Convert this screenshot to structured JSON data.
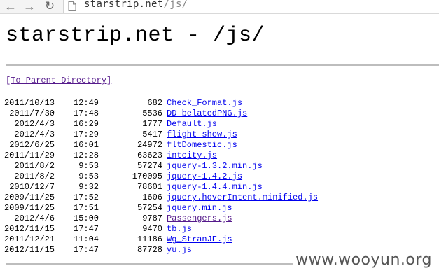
{
  "browser": {
    "url_host": "starstrip.net",
    "url_path": "/js/",
    "icons": {
      "back": "back-arrow-icon",
      "forward": "forward-arrow-icon",
      "reload": "reload-icon",
      "page": "page-icon"
    }
  },
  "page": {
    "title": "starstrip.net - /js/",
    "parent_link": "[To Parent Directory]"
  },
  "listing": [
    {
      "date": "2011/10/13",
      "time": "12:49",
      "size": "682",
      "name": "Check_Format.js"
    },
    {
      "date": "2011/7/30",
      "time": "17:48",
      "size": "5536",
      "name": "DD_belatedPNG.js"
    },
    {
      "date": "2012/4/3",
      "time": "16:29",
      "size": "1777",
      "name": "Default.js"
    },
    {
      "date": "2012/4/3",
      "time": "17:29",
      "size": "5417",
      "name": "flight_show.js"
    },
    {
      "date": "2012/6/25",
      "time": "16:01",
      "size": "24972",
      "name": "fltDomestic.js"
    },
    {
      "date": "2011/11/29",
      "time": "12:28",
      "size": "63623",
      "name": "intcity.js"
    },
    {
      "date": "2011/8/2",
      "time": "9:53",
      "size": "57274",
      "name": "jquery-1.3.2.min.js"
    },
    {
      "date": "2011/8/2",
      "time": "9:53",
      "size": "170095",
      "name": "jquery-1.4.2.js"
    },
    {
      "date": "2010/12/7",
      "time": "9:32",
      "size": "78601",
      "name": "jquery-1.4.4.min.js"
    },
    {
      "date": "2009/11/25",
      "time": "17:52",
      "size": "1606",
      "name": "jquery.hoverIntent.minified.js"
    },
    {
      "date": "2009/11/25",
      "time": "17:51",
      "size": "57254",
      "name": "jquery.min.js"
    },
    {
      "date": "2012/4/6",
      "time": "15:00",
      "size": "9787",
      "name": "Passengers.js"
    },
    {
      "date": "2012/11/15",
      "time": "17:47",
      "size": "9470",
      "name": "tb.js"
    },
    {
      "date": "2011/12/21",
      "time": "11:04",
      "size": "11186",
      "name": "Wg_StranJF.js"
    },
    {
      "date": "2012/11/15",
      "time": "17:47",
      "size": "87728",
      "name": "yu.js"
    }
  ],
  "visited_files": [
    "Passengers.js"
  ],
  "colors": {
    "link": "#0000ee",
    "visited_link": "#551a8b"
  },
  "watermark": "www.wooyun.org"
}
